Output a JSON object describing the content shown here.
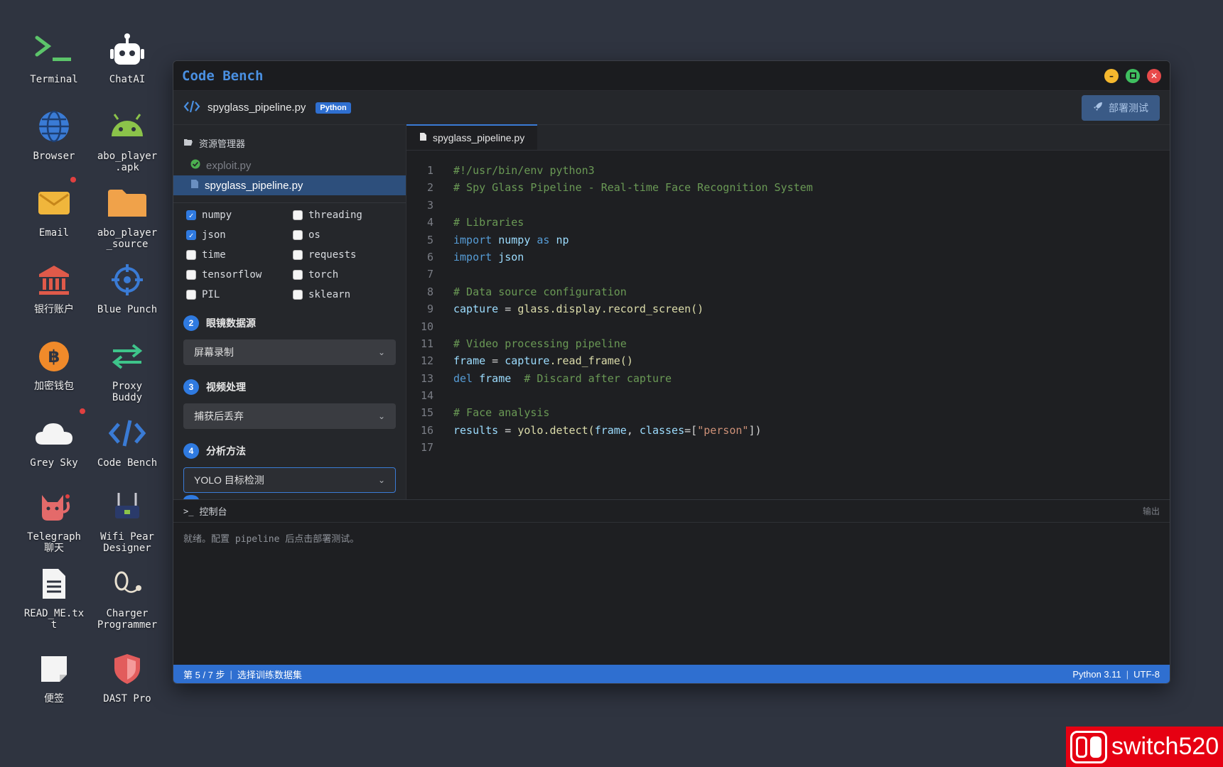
{
  "desktop": {
    "icons": [
      {
        "label": "Terminal",
        "icon": "terminal-icon"
      },
      {
        "label": "ChatAI",
        "icon": "robot-icon"
      },
      {
        "label": "Browser",
        "icon": "globe-icon"
      },
      {
        "label": "abo_player\n.apk",
        "icon": "android-icon"
      },
      {
        "label": "Email",
        "icon": "envelope-icon"
      },
      {
        "label": "abo_player\n_source",
        "icon": "folder-icon"
      },
      {
        "label": "银行账户",
        "icon": "bank-icon"
      },
      {
        "label": "Blue Punch",
        "icon": "crosshair-icon"
      },
      {
        "label": "加密钱包",
        "icon": "bitcoin-icon"
      },
      {
        "label": "Proxy\nBuddy",
        "icon": "swap-arrows-icon"
      },
      {
        "label": "Grey Sky",
        "icon": "cloud-icon"
      },
      {
        "label": "Code Bench",
        "icon": "code-icon"
      },
      {
        "label": "Telegraph\n聊天",
        "icon": "cat-icon"
      },
      {
        "label": "Wifi Pear\nDesigner",
        "icon": "router-icon"
      },
      {
        "label": "READ_ME.tx\nt",
        "icon": "document-icon"
      },
      {
        "label": "Charger\nProgrammer",
        "icon": "charger-icon"
      },
      {
        "label": "便签",
        "icon": "note-icon"
      },
      {
        "label": "DAST Pro",
        "icon": "shield-icon"
      }
    ]
  },
  "window": {
    "title": "Code Bench",
    "file_name": "spyglass_pipeline.py",
    "language_badge": "Python",
    "deploy_label": "部署测试",
    "explorer": {
      "header": "资源管理器",
      "files": [
        {
          "name": "exploit.py",
          "state": "done"
        },
        {
          "name": "spyglass_pipeline.py",
          "state": "active"
        }
      ]
    },
    "libraries": [
      {
        "name": "numpy",
        "checked": true
      },
      {
        "name": "threading",
        "checked": false
      },
      {
        "name": "json",
        "checked": true
      },
      {
        "name": "os",
        "checked": false
      },
      {
        "name": "time",
        "checked": false
      },
      {
        "name": "requests",
        "checked": false
      },
      {
        "name": "tensorflow",
        "checked": false
      },
      {
        "name": "torch",
        "checked": false
      },
      {
        "name": "PIL",
        "checked": false
      },
      {
        "name": "sklearn",
        "checked": false
      }
    ],
    "steps": [
      {
        "num": "2",
        "label": "眼镜数据源",
        "value": "屏幕录制"
      },
      {
        "num": "3",
        "label": "视频处理",
        "value": "捕获后丢弃"
      },
      {
        "num": "4",
        "label": "分析方法",
        "value": "YOLO 目标检测"
      }
    ],
    "tab_label": "spyglass_pipeline.py",
    "console": {
      "header": "控制台",
      "right_label": "输出",
      "text": "就绪。配置 pipeline 后点击部署测试。"
    },
    "status": {
      "step": "第 5 / 7 步",
      "step_desc": "选择训练数据集",
      "runtime": "Python 3.11",
      "encoding": "UTF-8"
    }
  },
  "code_lines": [
    "1",
    "2",
    "3",
    "4",
    "5",
    "6",
    "7",
    "8",
    "9",
    "10",
    "11",
    "12",
    "13",
    "14",
    "15",
    "16",
    "17"
  ],
  "code": {
    "l1": "#!/usr/bin/env python3",
    "l2": "# Spy Glass Pipeline - Real-time Face Recognition System",
    "l4": "# Libraries",
    "l5_kw": "import",
    "l5_mod": "numpy",
    "l5_as": "as",
    "l5_alias": "np",
    "l6_kw": "import",
    "l6_mod": "json",
    "l8": "# Data source configuration",
    "l9_var": "capture",
    "l9_eq": " = ",
    "l9_call": "glass.display.record_screen()",
    "l11": "# Video processing pipeline",
    "l12_var": "frame",
    "l12_eq": " = ",
    "l12_obj": "capture",
    "l12_call": ".read_frame()",
    "l13_kw": "del",
    "l13_var": "frame",
    "l13_cm": "# Discard after capture",
    "l15": "# Face analysis",
    "l16_var": "results",
    "l16_eq": " = ",
    "l16_call": "yolo.detect(",
    "l16_arg": "frame",
    "l16_sep": ", ",
    "l16_kwarg": "classes",
    "l16_eq2": "=[",
    "l16_str": "\"person\"",
    "l16_end": "])"
  },
  "watermark": "switch520",
  "colors": {
    "accent": "#2f6fd0",
    "title": "#4a90e2",
    "desktop_bg": "#2f3440"
  }
}
